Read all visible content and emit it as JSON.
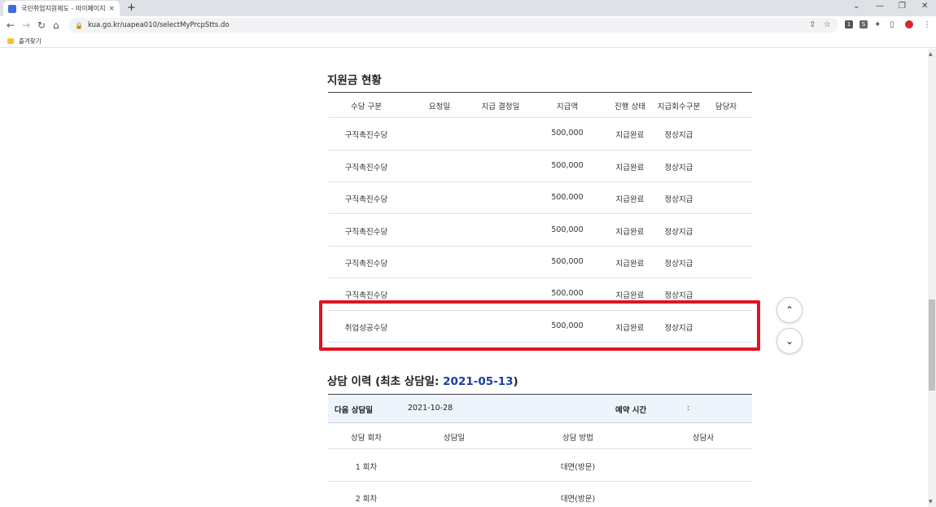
{
  "browser": {
    "tab_title": "국민취업지원제도 - 마이페이지",
    "tab_close": "×",
    "new_tab": "+",
    "url": "kua.go.kr/uapea010/selectMyPrcpStts.do",
    "bookmark_label": "즐겨찾기",
    "ext1": "1",
    "ext2": "S"
  },
  "support": {
    "title": "지원금 현황",
    "headers": [
      "수당 구분",
      "요청일",
      "지급 결정일",
      "지급액",
      "진행 상태",
      "지급회수구분",
      "담당자"
    ],
    "rows": [
      {
        "type": "구직촉진수당",
        "amount": "500,000",
        "status": "지급완료",
        "kind": "정상지급"
      },
      {
        "type": "구직촉진수당",
        "amount": "500,000",
        "status": "지급완료",
        "kind": "정상지급"
      },
      {
        "type": "구직촉진수당",
        "amount": "500,000",
        "status": "지급완료",
        "kind": "정상지급"
      },
      {
        "type": "구직촉진수당",
        "amount": "500,000",
        "status": "지급완료",
        "kind": "정상지급"
      },
      {
        "type": "구직촉진수당",
        "amount": "500,000",
        "status": "지급완료",
        "kind": "정상지급"
      },
      {
        "type": "구직촉진수당",
        "amount": "500,000",
        "status": "지급완료",
        "kind": "정상지급"
      },
      {
        "type": "취업성공수당",
        "amount": "500,000",
        "status": "지급완료",
        "kind": "정상지급"
      }
    ]
  },
  "consult": {
    "title_prefix": "상담 이력 (최초 상담일: ",
    "first_date": "2021-05-13",
    "title_suffix": ")",
    "next_label": "다음 상담일",
    "next_date": "2021-10-28",
    "reserve_label": "예약 시간",
    "reserve_value": ":",
    "headers": [
      "상담 회차",
      "상담일",
      "상담 방법",
      "상담사"
    ],
    "rows": [
      {
        "round": "1 회차",
        "method": "대면(방문)"
      },
      {
        "round": "2 회차",
        "method": "대면(방문)"
      }
    ]
  },
  "colors": {
    "accent": "#1a3fa6",
    "highlight": "#e0141e"
  }
}
